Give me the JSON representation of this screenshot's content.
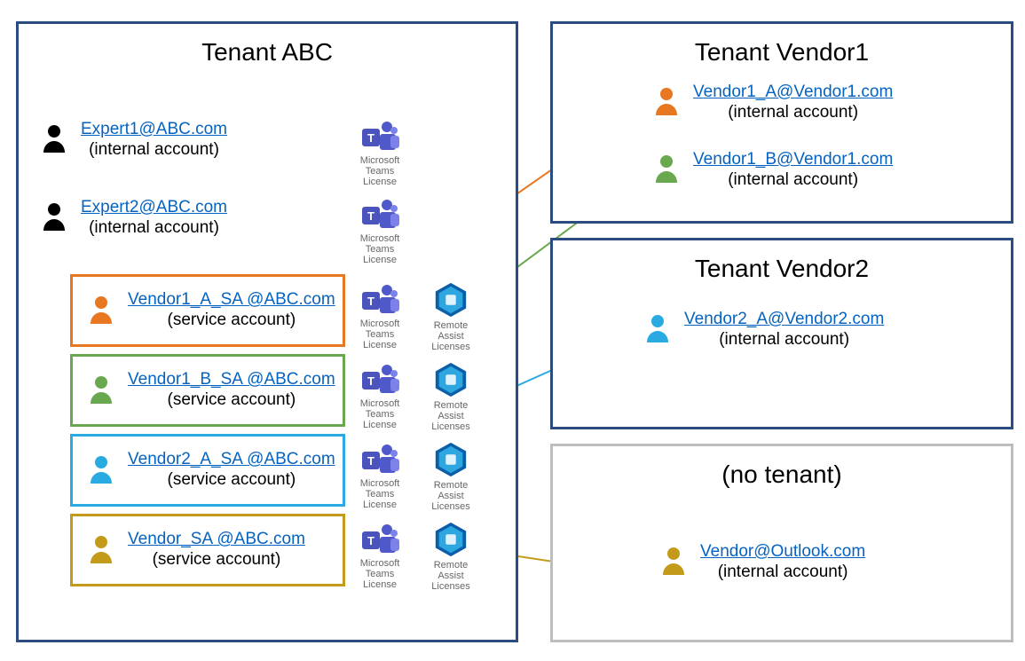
{
  "tenantABC": {
    "title": "Tenant ABC",
    "users": [
      {
        "email": "Expert1@ABC.com",
        "sub": "(internal account)"
      },
      {
        "email": "Expert2@ABC.com",
        "sub": "(internal account)"
      },
      {
        "email": "Vendor1_A_SA @ABC.com",
        "sub": "(service account)"
      },
      {
        "email": "Vendor1_B_SA @ABC.com",
        "sub": "(service account)"
      },
      {
        "email": "Vendor2_A_SA @ABC.com",
        "sub": "(service account)"
      },
      {
        "email": "Vendor_SA @ABC.com",
        "sub": "(service account)"
      }
    ]
  },
  "tenantVendor1": {
    "title": "Tenant Vendor1",
    "users": [
      {
        "email": "Vendor1_A@Vendor1.com",
        "sub": "(internal account)"
      },
      {
        "email": "Vendor1_B@Vendor1.com",
        "sub": "(internal account)"
      }
    ]
  },
  "tenantVendor2": {
    "title": "Tenant Vendor2",
    "users": [
      {
        "email": "Vendor2_A@Vendor2.com",
        "sub": "(internal account)"
      }
    ]
  },
  "noTenant": {
    "title": "(no tenant)",
    "users": [
      {
        "email": "Vendor@Outlook.com",
        "sub": "(internal account)"
      }
    ]
  },
  "licenseLabels": {
    "teams": "Microsoft Teams\nLicense",
    "remote": "Remote Assist\nLicenses"
  },
  "colors": {
    "navy": "#2b4c7e",
    "orange": "#e87722",
    "green": "#6aa84f",
    "blue": "#29abe2",
    "gold": "#c49a1a",
    "black": "#000000",
    "grey": "#bdbdbd"
  },
  "chart_data": {
    "type": "table",
    "title": "Tenant / service-account mapping diagram",
    "tenants": [
      {
        "name": "Tenant ABC",
        "accounts": [
          {
            "email": "Expert1@ABC.com",
            "kind": "internal account",
            "licenses": [
              "Microsoft Teams License"
            ]
          },
          {
            "email": "Expert2@ABC.com",
            "kind": "internal account",
            "licenses": [
              "Microsoft Teams License"
            ]
          },
          {
            "email": "Vendor1_A_SA @ABC.com",
            "kind": "service account",
            "licenses": [
              "Microsoft Teams License",
              "Remote Assist Licenses"
            ],
            "maps_to": "Vendor1_A@Vendor1.com",
            "color": "orange"
          },
          {
            "email": "Vendor1_B_SA @ABC.com",
            "kind": "service account",
            "licenses": [
              "Microsoft Teams License",
              "Remote Assist Licenses"
            ],
            "maps_to": "Vendor1_B@Vendor1.com",
            "color": "green"
          },
          {
            "email": "Vendor2_A_SA @ABC.com",
            "kind": "service account",
            "licenses": [
              "Microsoft Teams License",
              "Remote Assist Licenses"
            ],
            "maps_to": "Vendor2_A@Vendor2.com",
            "color": "blue"
          },
          {
            "email": "Vendor_SA @ABC.com",
            "kind": "service account",
            "licenses": [
              "Microsoft Teams License",
              "Remote Assist Licenses"
            ],
            "maps_to": "Vendor@Outlook.com",
            "color": "gold"
          }
        ]
      },
      {
        "name": "Tenant Vendor1",
        "accounts": [
          {
            "email": "Vendor1_A@Vendor1.com",
            "kind": "internal account"
          },
          {
            "email": "Vendor1_B@Vendor1.com",
            "kind": "internal account"
          }
        ]
      },
      {
        "name": "Tenant Vendor2",
        "accounts": [
          {
            "email": "Vendor2_A@Vendor2.com",
            "kind": "internal account"
          }
        ]
      },
      {
        "name": "(no tenant)",
        "accounts": [
          {
            "email": "Vendor@Outlook.com",
            "kind": "internal account"
          }
        ]
      }
    ]
  }
}
